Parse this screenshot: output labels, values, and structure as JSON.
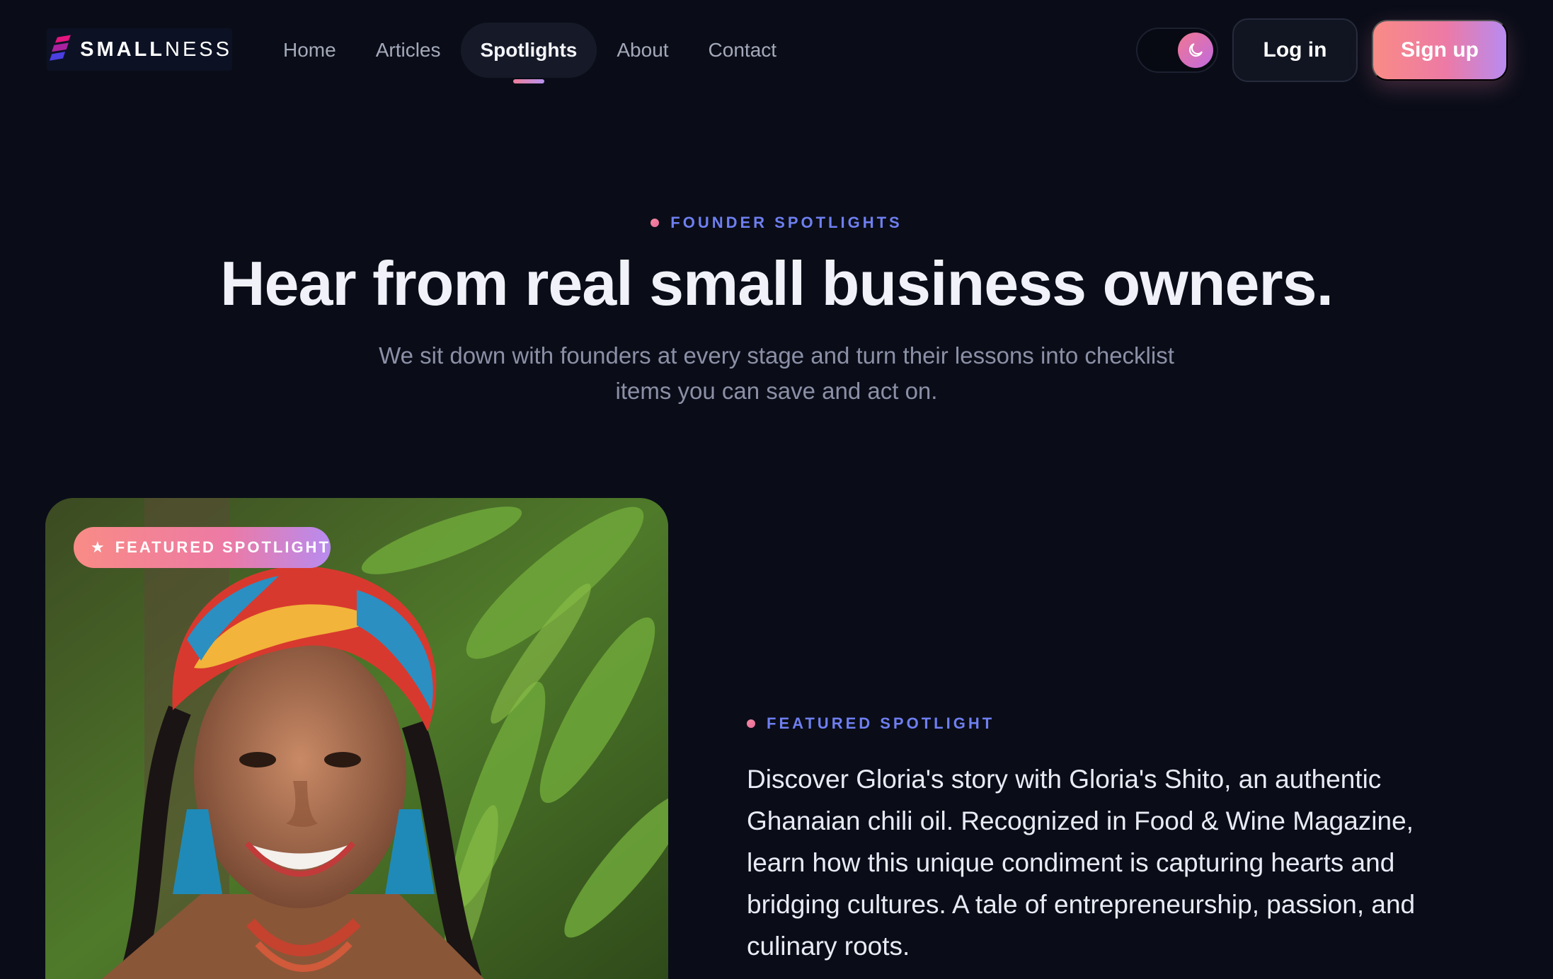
{
  "brand": {
    "bold": "SMALL",
    "light": "NESS",
    "colors": {
      "logo_magenta": "#e4157f",
      "logo_indigo": "#4b3fe0",
      "accent_pink": "#ec7aa5",
      "accent_violet": "#b88bf0",
      "eyebrow_blue": "#6f7ff0",
      "background": "#0a0d18"
    }
  },
  "nav": {
    "links": [
      {
        "label": "Home",
        "active": false
      },
      {
        "label": "Articles",
        "active": false
      },
      {
        "label": "Spotlights",
        "active": true
      },
      {
        "label": "About",
        "active": false
      },
      {
        "label": "Contact",
        "active": false
      }
    ],
    "theme_toggle_icon": "moon-icon",
    "login_label": "Log in",
    "signup_label": "Sign up"
  },
  "hero": {
    "eyebrow": "FOUNDER SPOTLIGHTS",
    "title": "Hear from real small business owners.",
    "subtitle": "We sit down with founders at every stage and turn their lessons into checklist items you can save and act on."
  },
  "featured": {
    "badge_icon": "star-icon",
    "badge_label": "FEATURED SPOTLIGHT",
    "eyebrow": "FEATURED SPOTLIGHT",
    "description": "Discover Gloria's story with Gloria's Shito, an authentic Ghanaian chili oil. Recognized in Food & Wine Magazine, learn how this unique condiment is capturing hearts and bridging cultures. A tale of entrepreneurship, passion, and culinary roots."
  }
}
